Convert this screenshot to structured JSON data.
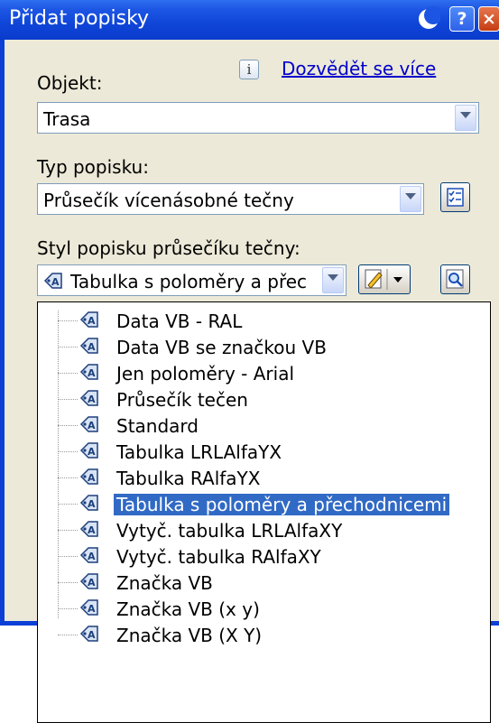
{
  "window": {
    "title": "Přidat popisky"
  },
  "object": {
    "label": "Objekt:",
    "value": "Trasa"
  },
  "info": {
    "link_text": "Dozvědět se více",
    "icon_glyph": "i"
  },
  "label_type": {
    "label": "Typ popisku:",
    "value": "Průsečík vícenásobné tečny"
  },
  "label_style": {
    "label": "Styl popisku průsečíku tečny:",
    "value": "Tabulka s poloměry a přec"
  },
  "style_list": {
    "items": [
      "Data VB - RAL",
      "Data VB se značkou VB",
      "Jen poloměry - Arial",
      "Průsečík tečen",
      "Standard",
      "Tabulka LRLAlfaYX",
      "Tabulka RAlfaYX",
      "Tabulka s poloměry a přechodnicemi",
      "Vytyč. tabulka LRLAlfaXY",
      "Vytyč. tabulka RAlfaXY",
      "Značka VB",
      "Značka VB  (x y)",
      "Značka VB  (X Y)"
    ],
    "selected": "Tabulka s poloměry a přechodnicemi"
  },
  "colors": {
    "title_bar": "#0a3bcc",
    "selection": "#316ac5",
    "dialog_bg": "#ece9d8",
    "link": "#0000cc"
  },
  "icons": [
    "moon-icon",
    "help-icon",
    "close-icon",
    "info-icon",
    "dropdown-arrow-icon",
    "style-settings-icon",
    "label-style-icon",
    "edit-pen-icon",
    "preview-magnifier-icon"
  ]
}
